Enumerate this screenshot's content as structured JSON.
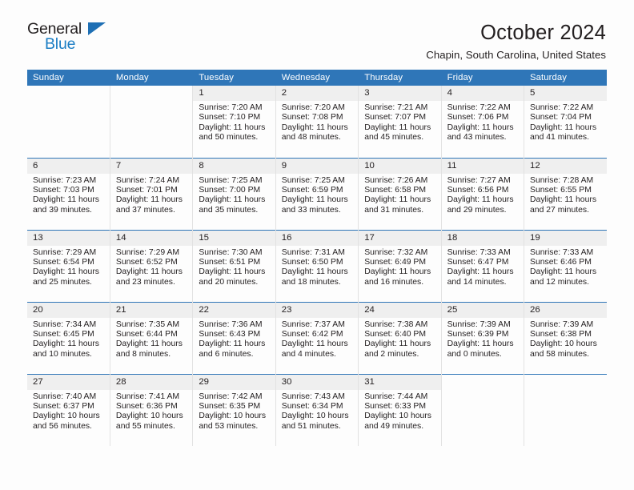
{
  "brand": {
    "name_part1": "General",
    "name_part2": "Blue",
    "accent_color": "#1a7dc4",
    "triangle_color": "#1e6fb4"
  },
  "header": {
    "title": "October 2024",
    "location": "Chapin, South Carolina, United States"
  },
  "theme": {
    "header_row_bg": "#2f76b8",
    "daynum_bg": "#efefef",
    "page_bg": "#fdfdfd",
    "text_color": "#231f20"
  },
  "weekday_headers": [
    "Sunday",
    "Monday",
    "Tuesday",
    "Wednesday",
    "Thursday",
    "Friday",
    "Saturday"
  ],
  "labels": {
    "sunrise_prefix": "Sunrise:",
    "sunset_prefix": "Sunset:",
    "daylight_prefix": "Daylight:"
  },
  "weeks": [
    [
      {
        "day": "",
        "blank": true
      },
      {
        "day": "",
        "blank": true
      },
      {
        "day": "1",
        "sunrise": "Sunrise: 7:20 AM",
        "sunset": "Sunset: 7:10 PM",
        "daylight_line1": "Daylight: 11 hours",
        "daylight_line2": "and 50 minutes."
      },
      {
        "day": "2",
        "sunrise": "Sunrise: 7:20 AM",
        "sunset": "Sunset: 7:08 PM",
        "daylight_line1": "Daylight: 11 hours",
        "daylight_line2": "and 48 minutes."
      },
      {
        "day": "3",
        "sunrise": "Sunrise: 7:21 AM",
        "sunset": "Sunset: 7:07 PM",
        "daylight_line1": "Daylight: 11 hours",
        "daylight_line2": "and 45 minutes."
      },
      {
        "day": "4",
        "sunrise": "Sunrise: 7:22 AM",
        "sunset": "Sunset: 7:06 PM",
        "daylight_line1": "Daylight: 11 hours",
        "daylight_line2": "and 43 minutes."
      },
      {
        "day": "5",
        "sunrise": "Sunrise: 7:22 AM",
        "sunset": "Sunset: 7:04 PM",
        "daylight_line1": "Daylight: 11 hours",
        "daylight_line2": "and 41 minutes."
      }
    ],
    [
      {
        "day": "6",
        "sunrise": "Sunrise: 7:23 AM",
        "sunset": "Sunset: 7:03 PM",
        "daylight_line1": "Daylight: 11 hours",
        "daylight_line2": "and 39 minutes."
      },
      {
        "day": "7",
        "sunrise": "Sunrise: 7:24 AM",
        "sunset": "Sunset: 7:01 PM",
        "daylight_line1": "Daylight: 11 hours",
        "daylight_line2": "and 37 minutes."
      },
      {
        "day": "8",
        "sunrise": "Sunrise: 7:25 AM",
        "sunset": "Sunset: 7:00 PM",
        "daylight_line1": "Daylight: 11 hours",
        "daylight_line2": "and 35 minutes."
      },
      {
        "day": "9",
        "sunrise": "Sunrise: 7:25 AM",
        "sunset": "Sunset: 6:59 PM",
        "daylight_line1": "Daylight: 11 hours",
        "daylight_line2": "and 33 minutes."
      },
      {
        "day": "10",
        "sunrise": "Sunrise: 7:26 AM",
        "sunset": "Sunset: 6:58 PM",
        "daylight_line1": "Daylight: 11 hours",
        "daylight_line2": "and 31 minutes."
      },
      {
        "day": "11",
        "sunrise": "Sunrise: 7:27 AM",
        "sunset": "Sunset: 6:56 PM",
        "daylight_line1": "Daylight: 11 hours",
        "daylight_line2": "and 29 minutes."
      },
      {
        "day": "12",
        "sunrise": "Sunrise: 7:28 AM",
        "sunset": "Sunset: 6:55 PM",
        "daylight_line1": "Daylight: 11 hours",
        "daylight_line2": "and 27 minutes."
      }
    ],
    [
      {
        "day": "13",
        "sunrise": "Sunrise: 7:29 AM",
        "sunset": "Sunset: 6:54 PM",
        "daylight_line1": "Daylight: 11 hours",
        "daylight_line2": "and 25 minutes."
      },
      {
        "day": "14",
        "sunrise": "Sunrise: 7:29 AM",
        "sunset": "Sunset: 6:52 PM",
        "daylight_line1": "Daylight: 11 hours",
        "daylight_line2": "and 23 minutes."
      },
      {
        "day": "15",
        "sunrise": "Sunrise: 7:30 AM",
        "sunset": "Sunset: 6:51 PM",
        "daylight_line1": "Daylight: 11 hours",
        "daylight_line2": "and 20 minutes."
      },
      {
        "day": "16",
        "sunrise": "Sunrise: 7:31 AM",
        "sunset": "Sunset: 6:50 PM",
        "daylight_line1": "Daylight: 11 hours",
        "daylight_line2": "and 18 minutes."
      },
      {
        "day": "17",
        "sunrise": "Sunrise: 7:32 AM",
        "sunset": "Sunset: 6:49 PM",
        "daylight_line1": "Daylight: 11 hours",
        "daylight_line2": "and 16 minutes."
      },
      {
        "day": "18",
        "sunrise": "Sunrise: 7:33 AM",
        "sunset": "Sunset: 6:47 PM",
        "daylight_line1": "Daylight: 11 hours",
        "daylight_line2": "and 14 minutes."
      },
      {
        "day": "19",
        "sunrise": "Sunrise: 7:33 AM",
        "sunset": "Sunset: 6:46 PM",
        "daylight_line1": "Daylight: 11 hours",
        "daylight_line2": "and 12 minutes."
      }
    ],
    [
      {
        "day": "20",
        "sunrise": "Sunrise: 7:34 AM",
        "sunset": "Sunset: 6:45 PM",
        "daylight_line1": "Daylight: 11 hours",
        "daylight_line2": "and 10 minutes."
      },
      {
        "day": "21",
        "sunrise": "Sunrise: 7:35 AM",
        "sunset": "Sunset: 6:44 PM",
        "daylight_line1": "Daylight: 11 hours",
        "daylight_line2": "and 8 minutes."
      },
      {
        "day": "22",
        "sunrise": "Sunrise: 7:36 AM",
        "sunset": "Sunset: 6:43 PM",
        "daylight_line1": "Daylight: 11 hours",
        "daylight_line2": "and 6 minutes."
      },
      {
        "day": "23",
        "sunrise": "Sunrise: 7:37 AM",
        "sunset": "Sunset: 6:42 PM",
        "daylight_line1": "Daylight: 11 hours",
        "daylight_line2": "and 4 minutes."
      },
      {
        "day": "24",
        "sunrise": "Sunrise: 7:38 AM",
        "sunset": "Sunset: 6:40 PM",
        "daylight_line1": "Daylight: 11 hours",
        "daylight_line2": "and 2 minutes."
      },
      {
        "day": "25",
        "sunrise": "Sunrise: 7:39 AM",
        "sunset": "Sunset: 6:39 PM",
        "daylight_line1": "Daylight: 11 hours",
        "daylight_line2": "and 0 minutes."
      },
      {
        "day": "26",
        "sunrise": "Sunrise: 7:39 AM",
        "sunset": "Sunset: 6:38 PM",
        "daylight_line1": "Daylight: 10 hours",
        "daylight_line2": "and 58 minutes."
      }
    ],
    [
      {
        "day": "27",
        "sunrise": "Sunrise: 7:40 AM",
        "sunset": "Sunset: 6:37 PM",
        "daylight_line1": "Daylight: 10 hours",
        "daylight_line2": "and 56 minutes."
      },
      {
        "day": "28",
        "sunrise": "Sunrise: 7:41 AM",
        "sunset": "Sunset: 6:36 PM",
        "daylight_line1": "Daylight: 10 hours",
        "daylight_line2": "and 55 minutes."
      },
      {
        "day": "29",
        "sunrise": "Sunrise: 7:42 AM",
        "sunset": "Sunset: 6:35 PM",
        "daylight_line1": "Daylight: 10 hours",
        "daylight_line2": "and 53 minutes."
      },
      {
        "day": "30",
        "sunrise": "Sunrise: 7:43 AM",
        "sunset": "Sunset: 6:34 PM",
        "daylight_line1": "Daylight: 10 hours",
        "daylight_line2": "and 51 minutes."
      },
      {
        "day": "31",
        "sunrise": "Sunrise: 7:44 AM",
        "sunset": "Sunset: 6:33 PM",
        "daylight_line1": "Daylight: 10 hours",
        "daylight_line2": "and 49 minutes."
      },
      {
        "day": "",
        "blank": true
      },
      {
        "day": "",
        "blank": true
      }
    ]
  ]
}
